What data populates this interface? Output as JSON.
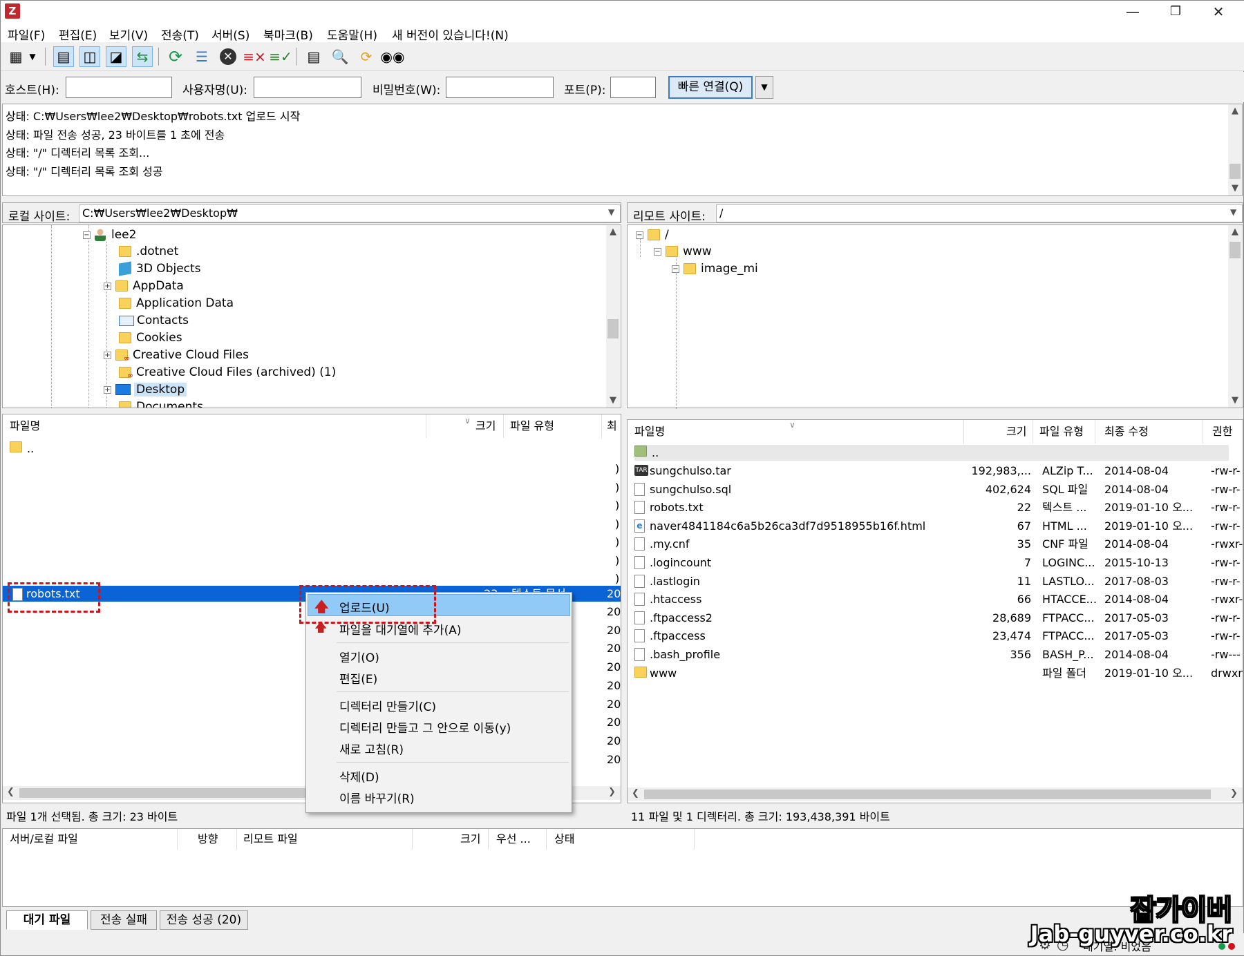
{
  "menu": [
    "파일(F)",
    "편집(E)",
    "보기(V)",
    "전송(T)",
    "서버(S)",
    "북마크(B)",
    "도움말(H)",
    "새 버전이 있습니다!(N)"
  ],
  "quickconnect": {
    "host_label": "호스트(H):",
    "user_label": "사용자명(U):",
    "pass_label": "비밀번호(W):",
    "port_label": "포트(P):",
    "connect_label": "빠른 연결(Q)"
  },
  "log": [
    "상태: C:₩Users₩lee2₩Desktop₩robots.txt 업로드 시작",
    "상태: 파일 전송 성공, 23 바이트를 1 초에 전송",
    "상태: \"/\" 디렉터리 목록 조회...",
    "상태: \"/\" 디렉터리 목록 조회 성공"
  ],
  "local": {
    "site_label": "로컬 사이트:",
    "path": "C:₩Users₩lee2₩Desktop₩",
    "tree": [
      "lee2",
      ".dotnet",
      "3D Objects",
      "AppData",
      "Application Data",
      "Contacts",
      "Cookies",
      "Creative Cloud Files",
      "Creative Cloud Files (archived) (1)",
      "Desktop",
      "Documents"
    ],
    "columns": [
      "파일명",
      "크기",
      "파일 유형",
      "최"
    ],
    "files": [
      {
        "name": ".."
      },
      {
        "name": "robots.txt",
        "size": "23",
        "type": "텍스트 문서",
        "date": "20"
      }
    ],
    "date_prefixes": [
      "20",
      "20",
      "20",
      "20",
      "20",
      "20",
      "20",
      "20",
      "20",
      "20"
    ],
    "status": "파일 1개 선택됨. 총 크기: 23 바이트"
  },
  "remote": {
    "site_label": "리모트 사이트:",
    "path": "/",
    "tree": [
      "/",
      "www",
      "image_mi"
    ],
    "columns": [
      "파일명",
      "크기",
      "파일 유형",
      "최종 수정",
      "권한"
    ],
    "files": [
      {
        "name": "..",
        "size": "",
        "type": "",
        "date": "",
        "perm": ""
      },
      {
        "name": "sungchulso.tar",
        "size": "192,983,...",
        "type": "ALZip T...",
        "date": "2014-08-04",
        "perm": "-rw-r-"
      },
      {
        "name": "sungchulso.sql",
        "size": "402,624",
        "type": "SQL 파일",
        "date": "2014-08-04",
        "perm": "-rw-r-"
      },
      {
        "name": "robots.txt",
        "size": "22",
        "type": "텍스트 ...",
        "date": "2019-01-10 오...",
        "perm": "-rw-r-"
      },
      {
        "name": "naver4841184c6a5b26ca3df7d9518955b16f.html",
        "size": "67",
        "type": "HTML ...",
        "date": "2019-01-10 오...",
        "perm": "-rw-r-"
      },
      {
        "name": ".my.cnf",
        "size": "35",
        "type": "CNF 파일",
        "date": "2014-08-04",
        "perm": "-rwxr-"
      },
      {
        "name": ".logincount",
        "size": "7",
        "type": "LOGINC...",
        "date": "2015-10-13",
        "perm": "-rw-r-"
      },
      {
        "name": ".lastlogin",
        "size": "11",
        "type": "LASTLO...",
        "date": "2017-08-03",
        "perm": "-rw-r-"
      },
      {
        "name": ".htaccess",
        "size": "66",
        "type": "HTACCE...",
        "date": "2014-08-04",
        "perm": "-rwxr-"
      },
      {
        "name": ".ftpaccess2",
        "size": "28,689",
        "type": "FTPACC...",
        "date": "2017-05-03",
        "perm": "-rw-r-"
      },
      {
        "name": ".ftpaccess",
        "size": "23,474",
        "type": "FTPACC...",
        "date": "2017-05-03",
        "perm": "-rw-r-"
      },
      {
        "name": ".bash_profile",
        "size": "356",
        "type": "BASH_P...",
        "date": "2014-08-04",
        "perm": "-rw---"
      },
      {
        "name": "www",
        "size": "",
        "type": "파일 폴더",
        "date": "2019-01-10 오...",
        "perm": "drwxr"
      }
    ],
    "status": "11 파일 및 1 디렉터리. 총 크기: 193,438,391 바이트"
  },
  "context_menu": [
    "업로드(U)",
    "파일을 대기열에 추가(A)",
    "열기(O)",
    "편집(E)",
    "디렉터리 만들기(C)",
    "디렉터리 만들고 그 안으로 이동(y)",
    "새로 고침(R)",
    "삭제(D)",
    "이름 바꾸기(R)"
  ],
  "queue": {
    "columns": [
      "서버/로컬 파일",
      "방향",
      "리모트 파일",
      "크기",
      "우선 ...",
      "상태"
    ],
    "tabs": [
      "대기 파일",
      "전송 실패",
      "전송 성공 (20)"
    ],
    "status_text": "대기열: 비었음"
  },
  "watermark": {
    "line1": "잡가이버",
    "line2": "Jab-guyver.co.kr"
  },
  "colors": {
    "selection": "#0a64d6",
    "context_highlight": "#91c9f7",
    "annotation": "#d0121b"
  }
}
